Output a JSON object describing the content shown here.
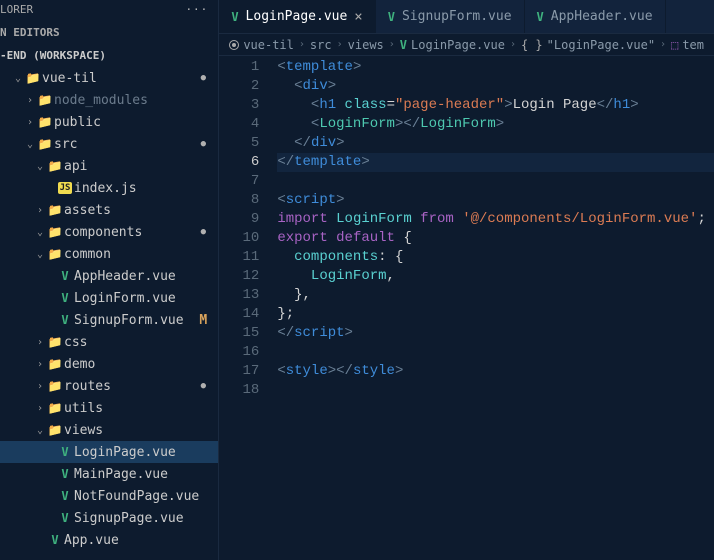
{
  "sidebar": {
    "header": "LORER",
    "sections": {
      "open_editors": "N EDITORS",
      "workspace": "-END (WORKSPACE)"
    },
    "items": {
      "vuetil": "vue-til",
      "node_modules": "node_modules",
      "public": "public",
      "src": "src",
      "api": "api",
      "indexjs": "index.js",
      "assets": "assets",
      "components": "components",
      "common": "common",
      "appheader": "AppHeader.vue",
      "loginform": "LoginForm.vue",
      "signupform": "SignupForm.vue",
      "css": "css",
      "demo": "demo",
      "routes": "routes",
      "utils": "utils",
      "views": "views",
      "loginpage": "LoginPage.vue",
      "mainpage": "MainPage.vue",
      "notfound": "NotFoundPage.vue",
      "signuppage": "SignupPage.vue",
      "appvue": "App.vue"
    },
    "status": {
      "M": "M"
    }
  },
  "tabs": [
    {
      "label": "LoginPage.vue",
      "active": true
    },
    {
      "label": "SignupForm.vue",
      "active": false
    },
    {
      "label": "AppHeader.vue",
      "active": false
    }
  ],
  "breadcrumb": {
    "c1": "vue-til",
    "c2": "src",
    "c3": "views",
    "c4": "LoginPage.vue",
    "c5": "\"LoginPage.vue\"",
    "c6": "tem"
  },
  "code": {
    "lines": [
      {
        "n": 1,
        "html": "<span class='tok-punct'>&lt;</span><span class='tok-tag'>template</span><span class='tok-punct'>&gt;</span>"
      },
      {
        "n": 2,
        "html": "  <span class='tok-punct'>&lt;</span><span class='tok-tag'>div</span><span class='tok-punct'>&gt;</span>"
      },
      {
        "n": 3,
        "html": "    <span class='tok-punct'>&lt;</span><span class='tok-tag'>h1</span> <span class='tok-attr'>class</span><span class='tok-sym'>=</span><span class='tok-str'>\"page-header\"</span><span class='tok-punct'>&gt;</span><span class='tok-text'>Login Page</span><span class='tok-punct'>&lt;/</span><span class='tok-tag'>h1</span><span class='tok-punct'>&gt;</span>"
      },
      {
        "n": 4,
        "html": "    <span class='tok-punct'>&lt;</span><span class='tok-compname'>LoginForm</span><span class='tok-punct'>&gt;&lt;/</span><span class='tok-compname'>LoginForm</span><span class='tok-punct'>&gt;</span>"
      },
      {
        "n": 5,
        "html": "  <span class='tok-punct'>&lt;/</span><span class='tok-tag'>div</span><span class='tok-punct'>&gt;</span>"
      },
      {
        "n": 6,
        "html": "<span class='tok-punct'>&lt;/</span><span class='tok-tag'>template</span><span class='tok-punct'>&gt;</span>",
        "current": true
      },
      {
        "n": 7,
        "html": ""
      },
      {
        "n": 8,
        "html": "<span class='tok-punct'>&lt;</span><span class='tok-tag'>script</span><span class='tok-punct'>&gt;</span>"
      },
      {
        "n": 9,
        "html": "<span class='tok-kw'>import</span> <span class='tok-ident'>LoginForm</span> <span class='tok-kw'>from</span> <span class='tok-str'>'@/components/LoginForm.vue'</span><span class='tok-sym'>;</span>"
      },
      {
        "n": 10,
        "html": "<span class='tok-kw'>export</span> <span class='tok-kw'>default</span> <span class='tok-sym'>{</span>"
      },
      {
        "n": 11,
        "html": "  <span class='tok-prop'>components</span><span class='tok-sym'>:</span> <span class='tok-sym'>{</span>"
      },
      {
        "n": 12,
        "html": "    <span class='tok-ident'>LoginForm</span><span class='tok-sym'>,</span>"
      },
      {
        "n": 13,
        "html": "  <span class='tok-sym'>},</span>"
      },
      {
        "n": 14,
        "html": "<span class='tok-sym'>};</span>"
      },
      {
        "n": 15,
        "html": "<span class='tok-punct'>&lt;/</span><span class='tok-tag'>script</span><span class='tok-punct'>&gt;</span>"
      },
      {
        "n": 16,
        "html": ""
      },
      {
        "n": 17,
        "html": "<span class='tok-punct'>&lt;</span><span class='tok-tag'>style</span><span class='tok-punct'>&gt;&lt;/</span><span class='tok-tag'>style</span><span class='tok-punct'>&gt;</span>"
      },
      {
        "n": 18,
        "html": ""
      }
    ]
  }
}
